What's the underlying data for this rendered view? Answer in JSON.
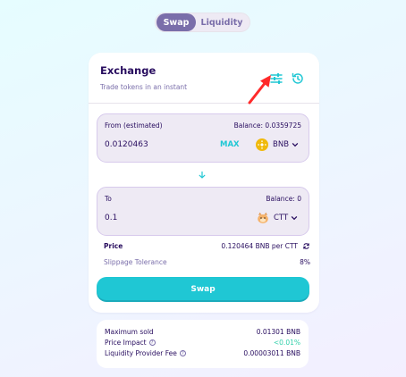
{
  "nav": {
    "tabs": [
      {
        "label": "Swap",
        "active": true
      },
      {
        "label": "Liquidity",
        "active": false
      }
    ]
  },
  "exchange": {
    "title": "Exchange",
    "subtitle": "Trade tokens in an instant",
    "icons": [
      "settings-sliders-icon",
      "history-icon"
    ]
  },
  "from": {
    "label": "From (estimated)",
    "balance": "Balance: 0.0359725",
    "amount": "0.0120463",
    "max_label": "MAX",
    "token": "BNB",
    "token_icon": "bnb-coin-icon"
  },
  "to": {
    "label": "To",
    "balance": "Balance: 0",
    "amount": "0.1",
    "token": "CTT",
    "token_icon": "cat-token-icon"
  },
  "info": {
    "price_label": "Price",
    "price_value": "0.120464 BNB per CTT",
    "slippage_label": "Slippage Tolerance",
    "slippage_value": "8%"
  },
  "swap_button": "Swap",
  "details": {
    "max_sold_label": "Maximum sold",
    "max_sold_value": "0.01301 BNB",
    "price_impact_label": "Price Impact",
    "price_impact_value": "<0.01%",
    "fee_label": "Liquidity Provider Fee",
    "fee_value": "0.00003011 BNB"
  },
  "colors": {
    "primary": "#1fc7d4",
    "text": "#280d5f",
    "secondary": "#7a6eaa",
    "success": "#31d0aa",
    "annotation": "#ff2a2a"
  }
}
